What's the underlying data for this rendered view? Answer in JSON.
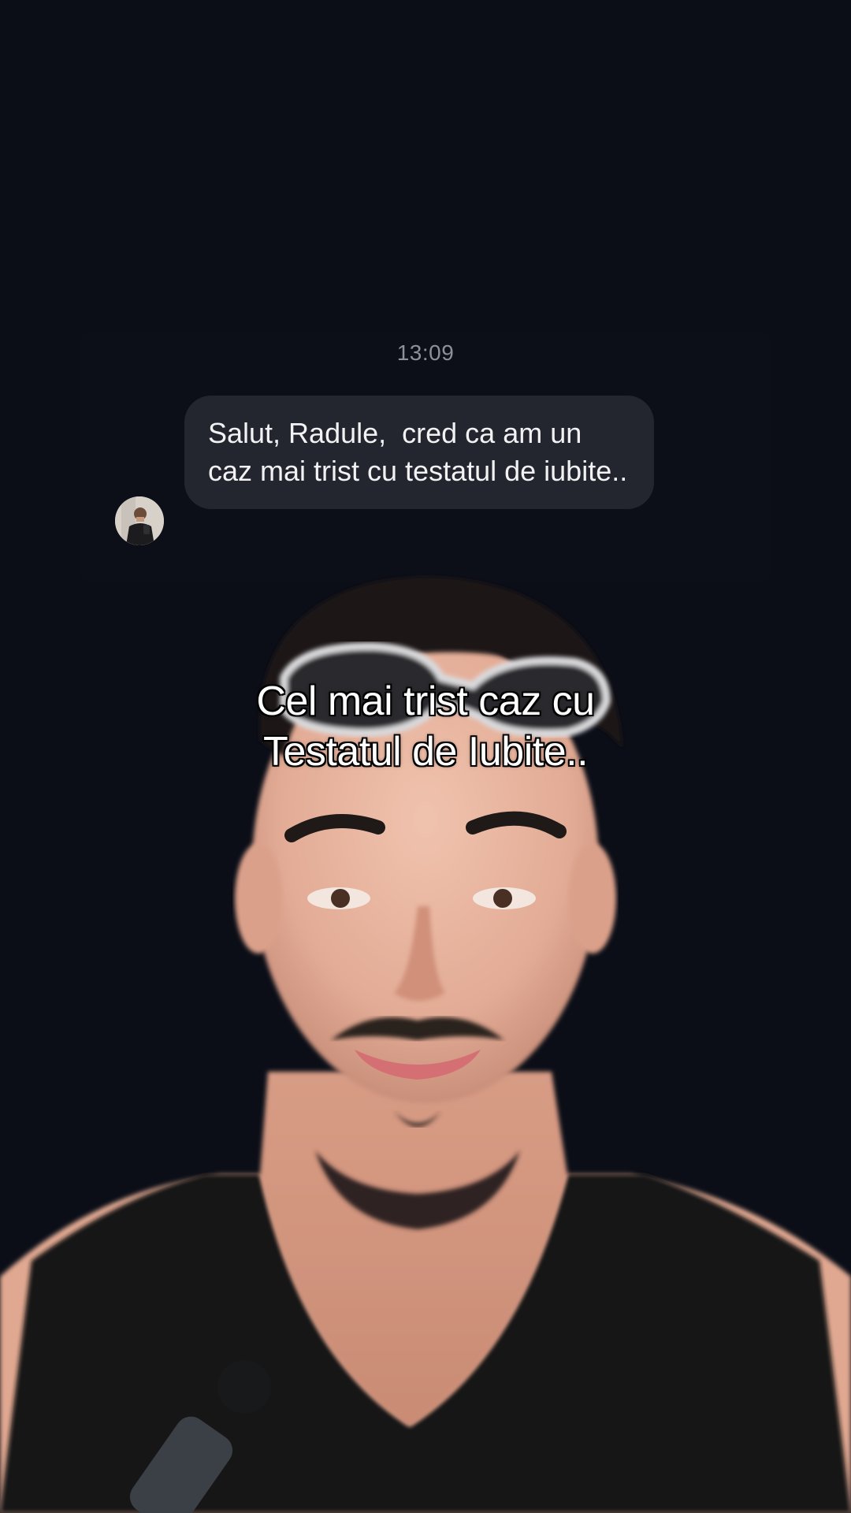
{
  "chat": {
    "timestamp": "13:09",
    "message": "Salut, Radule,  cred ca am un caz mai trist cu testatul de iubite..",
    "avatar_icon": "person-photo-avatar"
  },
  "caption": {
    "line1": "Cel mai trist caz cu",
    "line2": "Testatul de Iubite.."
  },
  "colors": {
    "background": "#0b0e17",
    "bubble": "#23262e",
    "bubble_text": "#f2f2f4",
    "timestamp": "#8d9099",
    "caption_text": "#ffffff",
    "caption_outline": "#000000"
  }
}
